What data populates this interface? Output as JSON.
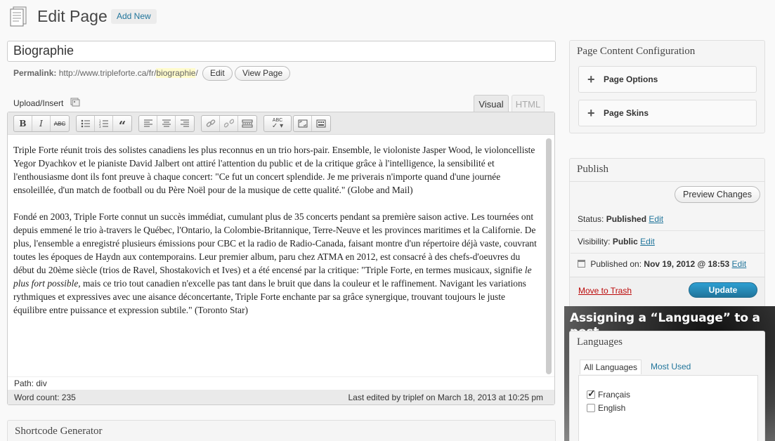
{
  "header": {
    "title": "Edit Page",
    "add_new": "Add New"
  },
  "post": {
    "title": "Biographie",
    "permalink_label": "Permalink:",
    "permalink_base": "http://www.tripleforte.ca/fr/",
    "permalink_slug": "biographie",
    "permalink_end": "/",
    "edit_btn": "Edit",
    "view_btn": "View Page"
  },
  "editor": {
    "upload_insert": "Upload/Insert",
    "tab_visual": "Visual",
    "tab_html": "HTML",
    "toolbar_icons": [
      "bold-icon",
      "italic-icon",
      "strikethrough-icon",
      "bullet-list-icon",
      "numbered-list-icon",
      "blockquote-icon",
      "align-left-icon",
      "align-center-icon",
      "align-right-icon",
      "link-icon",
      "unlink-icon",
      "more-tag-icon",
      "spellcheck-icon",
      "fullscreen-icon",
      "kitchen-sink-icon"
    ],
    "paragraph1": "Triple Forte réunit trois des solistes canadiens les plus reconnus en un trio hors-pair. Ensemble, le violoniste Jasper Wood, le violoncelliste Yegor Dyachkov et le pianiste David Jalbert ont attiré l'attention du public et de la critique grâce à l'intelligence, la sensibilité et l'enthousiasme dont ils font preuve à chaque concert: \"Ce fut un concert splendide. Je me priverais n'importe quand d'une journée ensoleillée, d'un match de football ou du Père Noël pour de la musique de cette qualité.\" (Globe and Mail)",
    "paragraph2_a": "Fondé en 2003, Triple Forte connut un succès immédiat, cumulant plus de 35 concerts pendant sa première saison active. Les tournées ont depuis emmené le trio à-travers le Québec, l'Ontario, la Colombie-Britannique, Terre-Neuve et les provinces maritimes et la Californie. De plus, l'ensemble a enregistré plusieurs émissions pour CBC et la radio de Radio-Canada, faisant montre d'un répertoire déjà vaste, couvrant toutes les époques de Haydn aux contemporains. Leur premier album, paru chez ATMA en 2012, est consacré à des chefs-d'oeuvres du début du 20ème siècle (trios de Ravel, Shostakovich et Ives) et a été encensé par la critique: \"Triple Forte, en termes musicaux, signifie ",
    "paragraph2_em": "le plus fort possible,",
    "paragraph2_b": " mais ce trio tout canadien n'excelle pas tant dans le bruit que dans la couleur et le raffinement. Navigant les variations rythmiques et expressives avec une aisance déconcertante, Triple Forte enchante par sa grâce synergique, trouvant toujours le juste équilibre entre puissance et expression subtile.\" (Toronto Star)",
    "path_label": "Path:",
    "path_value": "div",
    "word_count": "Word count: 235",
    "last_edited": "Last edited by triplef on March 18, 2013 at 10:25 pm"
  },
  "shortcode": {
    "title": "Shortcode Generator"
  },
  "page_content_config": {
    "title": "Page Content Configuration",
    "options": "Page Options",
    "skins": "Page Skins"
  },
  "publish": {
    "title": "Publish",
    "preview": "Preview Changes",
    "status_label": "Status:",
    "status_value": "Published",
    "visibility_label": "Visibility:",
    "visibility_value": "Public",
    "published_label": "Published on:",
    "published_value": "Nov 19, 2012 @ 18:53",
    "edit": "Edit",
    "trash": "Move to Trash",
    "update": "Update"
  },
  "languages": {
    "caption": "Assigning a “Language” to a post",
    "title": "Languages",
    "tab_all": "All Languages",
    "tab_most_used": "Most Used",
    "items": [
      {
        "label": "Français",
        "checked": true
      },
      {
        "label": "English",
        "checked": false
      }
    ]
  }
}
